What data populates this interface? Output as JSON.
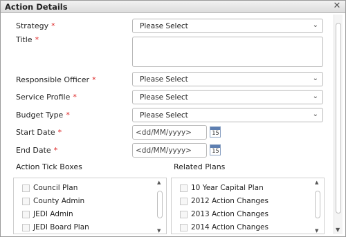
{
  "dialog": {
    "title": "Action Details",
    "close_glyph": "✕"
  },
  "form": {
    "strategy": {
      "label": "Strategy",
      "value": "Please Select"
    },
    "title_field": {
      "label": "Title",
      "value": ""
    },
    "responsible_officer": {
      "label": "Responsible Officer",
      "value": "Please Select"
    },
    "service_profile": {
      "label": "Service Profile",
      "value": "Please Select"
    },
    "budget_type": {
      "label": "Budget Type",
      "value": "Please Select"
    },
    "start_date": {
      "label": "Start Date",
      "placeholder": "<dd/MM/yyyy>",
      "calendar_day": "15"
    },
    "end_date": {
      "label": "End Date",
      "placeholder": "<dd/MM/yyyy>",
      "calendar_day": "15"
    },
    "required_marker": "*"
  },
  "action_tick_boxes": {
    "label": "Action Tick Boxes",
    "items": [
      "Council Plan",
      "County Admin",
      "JEDI Admin",
      "JEDI Board Plan"
    ]
  },
  "related_plans": {
    "label": "Related Plans",
    "items": [
      "10 Year Capital Plan",
      "2012 Action Changes",
      "2013 Action Changes",
      "2014 Action Changes"
    ]
  },
  "icons": {
    "chevron": "chevron-down-icon",
    "calendar": "calendar-icon",
    "close": "close-icon"
  },
  "colors": {
    "required": "#dd2222",
    "calendar_header": "#5e7fb1"
  }
}
